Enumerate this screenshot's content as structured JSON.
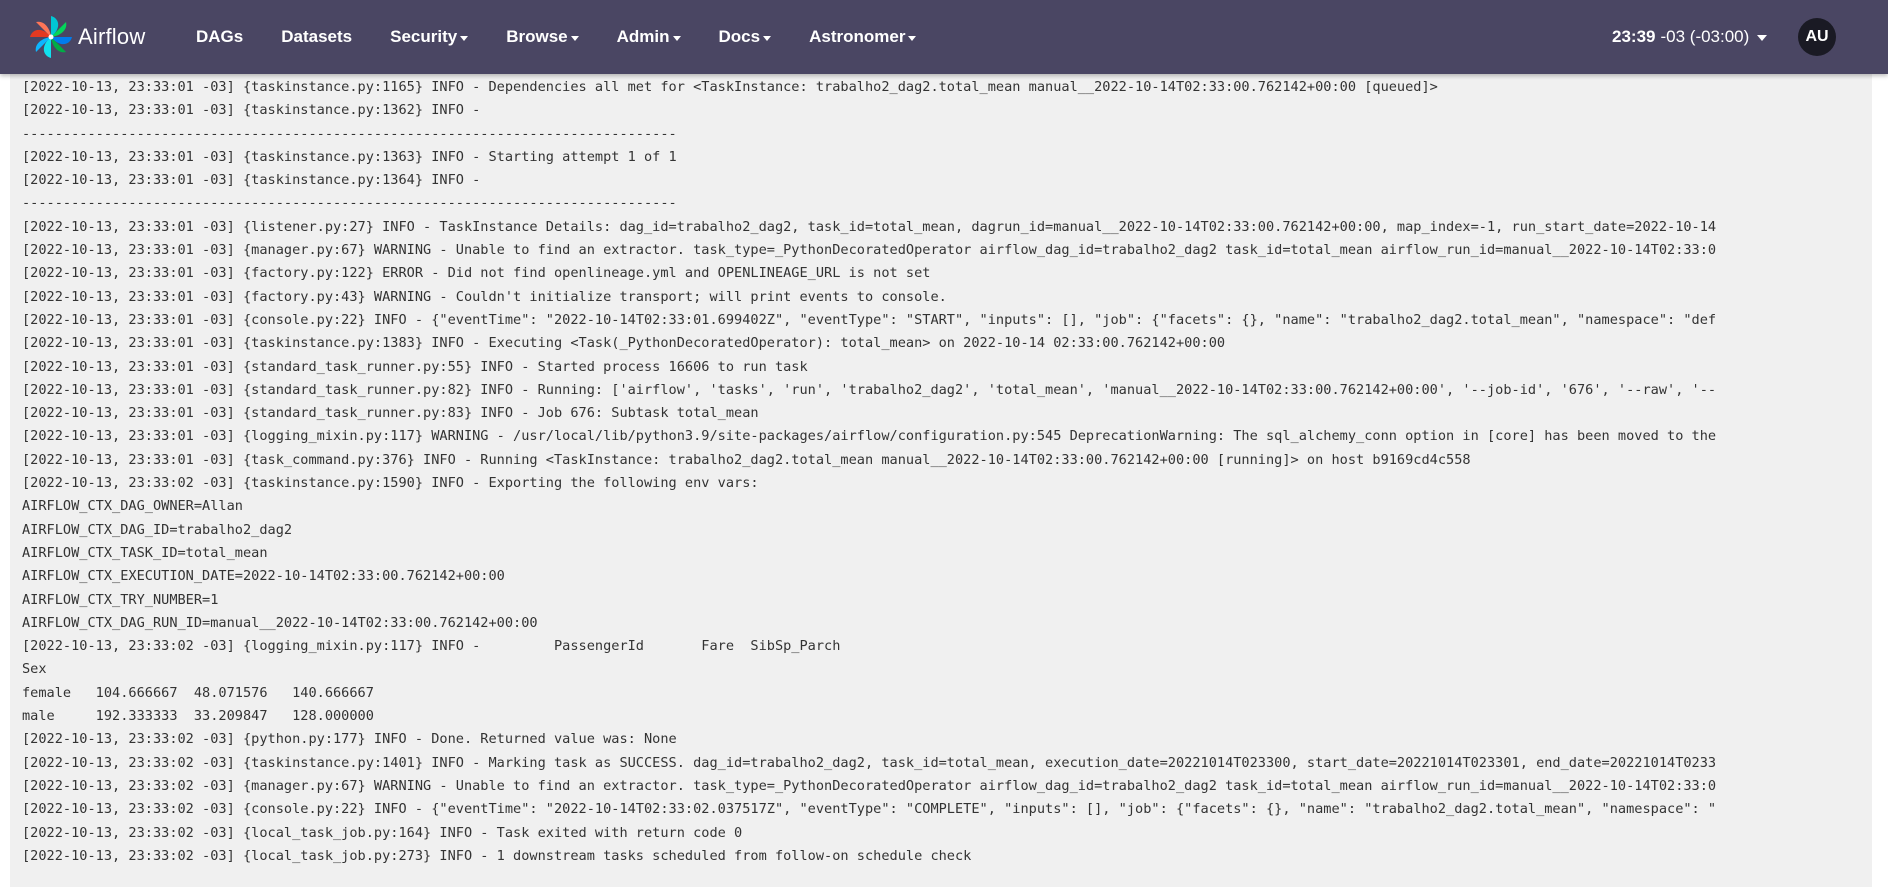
{
  "navbar": {
    "brand": "Airflow",
    "items": [
      {
        "label": "DAGs",
        "dropdown": false
      },
      {
        "label": "Datasets",
        "dropdown": false
      },
      {
        "label": "Security",
        "dropdown": true
      },
      {
        "label": "Browse",
        "dropdown": true
      },
      {
        "label": "Admin",
        "dropdown": true
      },
      {
        "label": "Docs",
        "dropdown": true
      },
      {
        "label": "Astronomer",
        "dropdown": true
      }
    ],
    "clock_time": "23:39",
    "clock_zone": "-03 (-03:00)",
    "user_initials": "AU"
  },
  "colors": {
    "navbar_bg": "#4a4663",
    "log_bg": "#f0f0f0",
    "log_text": "#333333"
  },
  "log": {
    "lines": [
      "[2022-10-13, 23:33:01 -03] {taskinstance.py:1165} INFO - Dependencies all met for <TaskInstance: trabalho2_dag2.total_mean manual__2022-10-14T02:33:00.762142+00:00 [queued]>",
      "[2022-10-13, 23:33:01 -03] {taskinstance.py:1362} INFO -",
      "--------------------------------------------------------------------------------",
      "[2022-10-13, 23:33:01 -03] {taskinstance.py:1363} INFO - Starting attempt 1 of 1",
      "[2022-10-13, 23:33:01 -03] {taskinstance.py:1364} INFO -",
      "--------------------------------------------------------------------------------",
      "[2022-10-13, 23:33:01 -03] {listener.py:27} INFO - TaskInstance Details: dag_id=trabalho2_dag2, task_id=total_mean, dagrun_id=manual__2022-10-14T02:33:00.762142+00:00, map_index=-1, run_start_date=2022-10-14",
      "[2022-10-13, 23:33:01 -03] {manager.py:67} WARNING - Unable to find an extractor. task_type=_PythonDecoratedOperator airflow_dag_id=trabalho2_dag2 task_id=total_mean airflow_run_id=manual__2022-10-14T02:33:0",
      "[2022-10-13, 23:33:01 -03] {factory.py:122} ERROR - Did not find openlineage.yml and OPENLINEAGE_URL is not set",
      "[2022-10-13, 23:33:01 -03] {factory.py:43} WARNING - Couldn't initialize transport; will print events to console.",
      "[2022-10-13, 23:33:01 -03] {console.py:22} INFO - {\"eventTime\": \"2022-10-14T02:33:01.699402Z\", \"eventType\": \"START\", \"inputs\": [], \"job\": {\"facets\": {}, \"name\": \"trabalho2_dag2.total_mean\", \"namespace\": \"def",
      "[2022-10-13, 23:33:01 -03] {taskinstance.py:1383} INFO - Executing <Task(_PythonDecoratedOperator): total_mean> on 2022-10-14 02:33:00.762142+00:00",
      "[2022-10-13, 23:33:01 -03] {standard_task_runner.py:55} INFO - Started process 16606 to run task",
      "[2022-10-13, 23:33:01 -03] {standard_task_runner.py:82} INFO - Running: ['airflow', 'tasks', 'run', 'trabalho2_dag2', 'total_mean', 'manual__2022-10-14T02:33:00.762142+00:00', '--job-id', '676', '--raw', '--",
      "[2022-10-13, 23:33:01 -03] {standard_task_runner.py:83} INFO - Job 676: Subtask total_mean",
      "[2022-10-13, 23:33:01 -03] {logging_mixin.py:117} WARNING - /usr/local/lib/python3.9/site-packages/airflow/configuration.py:545 DeprecationWarning: The sql_alchemy_conn option in [core] has been moved to the",
      "[2022-10-13, 23:33:01 -03] {task_command.py:376} INFO - Running <TaskInstance: trabalho2_dag2.total_mean manual__2022-10-14T02:33:00.762142+00:00 [running]> on host b9169cd4c558",
      "[2022-10-13, 23:33:02 -03] {taskinstance.py:1590} INFO - Exporting the following env vars:",
      "AIRFLOW_CTX_DAG_OWNER=Allan",
      "AIRFLOW_CTX_DAG_ID=trabalho2_dag2",
      "AIRFLOW_CTX_TASK_ID=total_mean",
      "AIRFLOW_CTX_EXECUTION_DATE=2022-10-14T02:33:00.762142+00:00",
      "AIRFLOW_CTX_TRY_NUMBER=1",
      "AIRFLOW_CTX_DAG_RUN_ID=manual__2022-10-14T02:33:00.762142+00:00",
      "[2022-10-13, 23:33:02 -03] {logging_mixin.py:117} INFO -         PassengerId       Fare  SibSp_Parch",
      "Sex",
      "female   104.666667  48.071576   140.666667",
      "male     192.333333  33.209847   128.000000",
      "[2022-10-13, 23:33:02 -03] {python.py:177} INFO - Done. Returned value was: None",
      "[2022-10-13, 23:33:02 -03] {taskinstance.py:1401} INFO - Marking task as SUCCESS. dag_id=trabalho2_dag2, task_id=total_mean, execution_date=20221014T023300, start_date=20221014T023301, end_date=20221014T0233",
      "[2022-10-13, 23:33:02 -03] {manager.py:67} WARNING - Unable to find an extractor. task_type=_PythonDecoratedOperator airflow_dag_id=trabalho2_dag2 task_id=total_mean airflow_run_id=manual__2022-10-14T02:33:0",
      "[2022-10-13, 23:33:02 -03] {console.py:22} INFO - {\"eventTime\": \"2022-10-14T02:33:02.037517Z\", \"eventType\": \"COMPLETE\", \"inputs\": [], \"job\": {\"facets\": {}, \"name\": \"trabalho2_dag2.total_mean\", \"namespace\": \"",
      "[2022-10-13, 23:33:02 -03] {local_task_job.py:164} INFO - Task exited with return code 0",
      "[2022-10-13, 23:33:02 -03] {local_task_job.py:273} INFO - 1 downstream tasks scheduled from follow-on schedule check"
    ]
  }
}
